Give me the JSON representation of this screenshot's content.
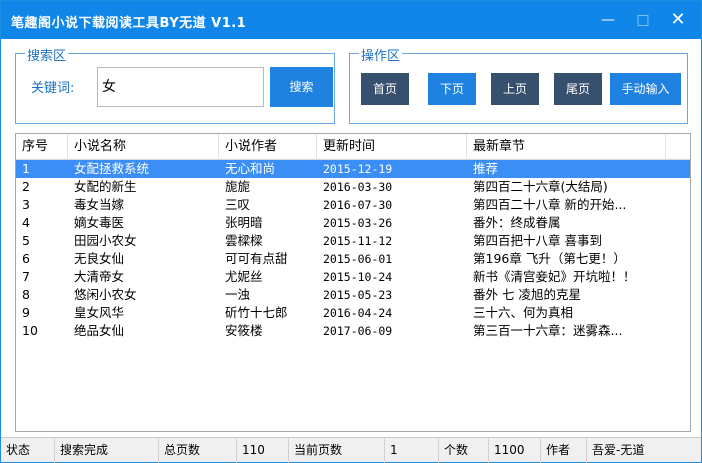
{
  "window": {
    "title": "笔趣阁小说下载阅读工具BY无道  V1.1",
    "minimize": "—",
    "maximize": "□",
    "close": "✕"
  },
  "search": {
    "group_label": "搜索区",
    "keyword_label": "关键词:",
    "keyword_value": "女",
    "search_button": "搜索"
  },
  "operations": {
    "group_label": "操作区",
    "first_page": "首页",
    "next_page": "下页",
    "prev_page": "上页",
    "last_page": "尾页",
    "manual_input": "手动输入"
  },
  "table": {
    "columns": [
      "序号",
      "小说名称",
      "小说作者",
      "更新时间",
      "最新章节"
    ],
    "selected_index": 0,
    "rows": [
      {
        "no": "1",
        "name": "女配拯救系统",
        "author": "无心和尚",
        "updated": "2015-12-19",
        "latest": "推荐"
      },
      {
        "no": "2",
        "name": "女配的新生",
        "author": "旎旎",
        "updated": "2016-03-30",
        "latest": "第四百二十六章(大结局)"
      },
      {
        "no": "3",
        "name": "毒女当嫁",
        "author": "三叹",
        "updated": "2016-07-30",
        "latest": "第四百二十八章 新的开始..."
      },
      {
        "no": "4",
        "name": "嫡女毒医",
        "author": "张明暗",
        "updated": "2015-03-26",
        "latest": "番外：终成眷属"
      },
      {
        "no": "5",
        "name": "田园小农女",
        "author": "雲樑樑",
        "updated": "2015-11-12",
        "latest": "第四百把十八章 喜事到"
      },
      {
        "no": "6",
        "name": "无良女仙",
        "author": "可可有点甜",
        "updated": "2015-06-01",
        "latest": "第196章 飞升（第七更！）"
      },
      {
        "no": "7",
        "name": "大清帝女",
        "author": "尤妮丝",
        "updated": "2015-10-24",
        "latest": "新书《清宫妾妃》开坑啦！！"
      },
      {
        "no": "8",
        "name": "悠闲小农女",
        "author": "一浊",
        "updated": "2015-05-23",
        "latest": "番外 七 凌旭的克星"
      },
      {
        "no": "9",
        "name": "皇女风华",
        "author": "斫竹十七郎",
        "updated": "2016-04-24",
        "latest": "三十六、何为真相"
      },
      {
        "no": "10",
        "name": "绝品女仙",
        "author": "安筱楼",
        "updated": "2017-06-09",
        "latest": "第三百一十六章：迷雾森..."
      }
    ]
  },
  "statusbar": {
    "state_label": "状态",
    "state_value": "搜索完成",
    "total_pages_label": "总页数",
    "total_pages_value": "110",
    "current_page_label": "当前页数",
    "current_page_value": "1",
    "count_label": "个数",
    "count_value": "1100",
    "author_label": "作者",
    "author_value": "吾爱-无道"
  },
  "colors": {
    "titlebar": "#0f86e8",
    "accent": "#1f82e0",
    "dark_button": "#36506e",
    "selection": "#3a8ef5"
  }
}
